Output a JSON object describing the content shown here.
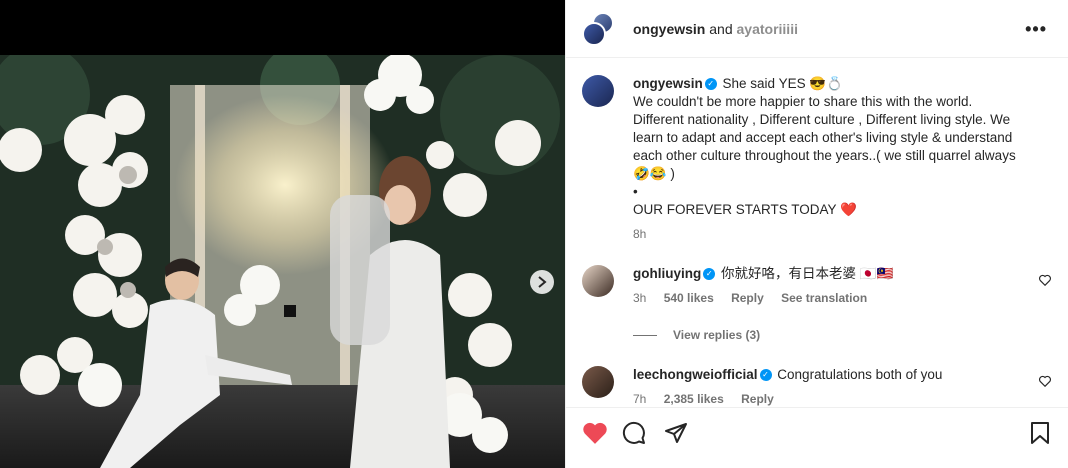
{
  "post": {
    "header": {
      "user1": "ongyewsin",
      "and": "and",
      "user2": "ayatoriiiii",
      "more": "•••"
    },
    "caption": {
      "username": "ongyewsin",
      "lines": [
        "She said YES 😎💍",
        "We couldn't be more happier to share this with the world.",
        "Different nationality , Different culture , Different living style. We",
        "learn to adapt and accept each other's living style & understand",
        "each other culture throughout the years..( we still quarrel always",
        "🤣😂 )",
        "•",
        "OUR FOREVER STARTS TODAY ❤️"
      ],
      "time": "8h"
    },
    "comments": [
      {
        "username": "gohliuying",
        "text": "你就好咯，有日本老婆 🇯🇵🇲🇾",
        "time": "3h",
        "likes": "540 likes",
        "reply": "Reply",
        "translate": "See translation"
      },
      {
        "username": "leechongweiofficial",
        "text": "Congratulations both of you",
        "time": "7h",
        "likes": "2,385 likes",
        "reply": "Reply"
      }
    ],
    "view_replies": "View replies (3)",
    "colors": {
      "heart": "#ed4956",
      "verified": "#0095f6"
    }
  }
}
